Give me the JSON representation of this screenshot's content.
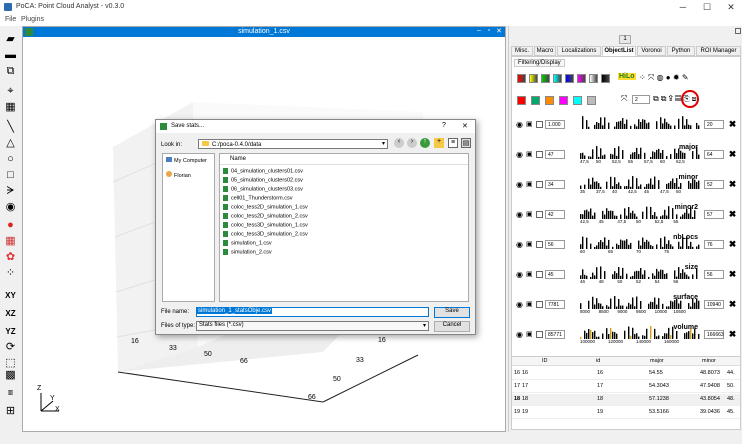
{
  "app": {
    "title": "PoCA: Point Cloud Analyst - v0.3.0",
    "menus": [
      "File",
      "Plugins"
    ]
  },
  "window_controls": {
    "minimize": "─",
    "maximize": "☐",
    "close": "✕"
  },
  "toolbar": {
    "icons": [
      "open-file-icon",
      "open-folder-icon",
      "screenshot-icon",
      "roi-select-icon",
      "line-roi-icon",
      "triangle-roi-icon",
      "circle-roi-icon",
      "square-roi-icon",
      "polyline-roi-icon",
      "sphere-roi-icon",
      "ellipse-icon",
      "grid-icon",
      "colormap-icon",
      "xy-view",
      "xz-view",
      "yz-view",
      "rotate-icon",
      "cube-select-icon",
      "grid-toggle-icon",
      "ruler-icon",
      "layout-icon"
    ],
    "labels": {
      "xy": "XY",
      "xz": "XZ",
      "yz": "YZ"
    }
  },
  "viewer": {
    "title": "simulation_1.csv",
    "axis_ticks_left": [
      "16",
      "33",
      "50",
      "66"
    ],
    "axis_ticks_right": [
      "16",
      "33",
      "50",
      "66"
    ],
    "axes": {
      "z": "Z",
      "y": "Y",
      "x": "X"
    }
  },
  "dialog": {
    "title": "Save stats...",
    "help": "?",
    "close": "✕",
    "look_in_label": "Look in:",
    "look_in_value": "C:/poca-0.4.0/data",
    "places": [
      "My Computer",
      "Florian"
    ],
    "name_header": "Name",
    "files": [
      "04_simulation_clusters01.csv",
      "05_simulation_clusters02.csv",
      "06_simulation_clusters03.csv",
      "cell01_Thunderstorm.csv",
      "coloc_tess2D_simulation_1.csv",
      "coloc_tess2D_simulation_2.csv",
      "coloc_tess3D_simulation_1.csv",
      "coloc_tess3D_simulation_2.csv",
      "simulation_1.csv",
      "simulation_2.csv"
    ],
    "filename_label": "File name:",
    "filename_value": "simulation_1_statsObje.csv",
    "filetype_label": "Files of type:",
    "filetype_value": "Stats files (*.csv)",
    "save": "Save",
    "cancel": "Cancel"
  },
  "panel": {
    "tab_index": "1",
    "tabs": [
      "Misc.",
      "Macro",
      "Localizations",
      "ObjectList",
      "Voronoi",
      "Python",
      "ROI Manager"
    ],
    "active_tab": "ObjectList",
    "subtab": "Filtering/Display",
    "palette_row1": [
      "#ff0000",
      "#ffff00",
      "#00cc00",
      "#00ffff",
      "#0000ff",
      "#ff00ff",
      "#ffffff",
      "#000000"
    ],
    "palette_row2": [
      "#ff0000",
      "#00a86b",
      "#ff8c00",
      "#ff00ff",
      "#00ffff",
      "#bbbbbb"
    ],
    "hilo": "HiLo",
    "point_size": "2",
    "histograms": [
      {
        "name": "",
        "left": "1.000",
        "right": "20",
        "ticks": []
      },
      {
        "name": "major",
        "left": "47",
        "right": "64",
        "ticks": [
          "47,5",
          "50",
          "52,5",
          "55",
          "57,5",
          "60",
          "62,5"
        ]
      },
      {
        "name": "minor",
        "left": "34",
        "right": "52",
        "ticks": [
          "35",
          "37,5",
          "40",
          "42,5",
          "45",
          "47,5",
          "50"
        ]
      },
      {
        "name": "minor2",
        "left": "42",
        "right": "57",
        "ticks": [
          "42,5",
          "45",
          "47,5",
          "50",
          "52,5",
          "55"
        ]
      },
      {
        "name": "nbLocs",
        "left": "56",
        "right": "76",
        "ticks": [
          "60",
          "65",
          "70",
          "75"
        ]
      },
      {
        "name": "size",
        "left": "45",
        "right": "56",
        "ticks": [
          "46",
          "48",
          "50",
          "52",
          "54",
          "56"
        ]
      },
      {
        "name": "surface",
        "left": "7781",
        "right": "10940",
        "ticks": [
          "8000",
          "8500",
          "9000",
          "9500",
          "10000",
          "10500"
        ]
      },
      {
        "name": "volume",
        "left": "85771",
        "right": "166663",
        "ticks": [
          "100000",
          "120000",
          "140000",
          "160000"
        ]
      }
    ],
    "table": {
      "headers": [
        "ID",
        "id",
        "major",
        "minor"
      ],
      "rows": [
        {
          "rowid": "16",
          "id": "16",
          "idv": "16",
          "major": "54.55",
          "minor": "48.8073",
          "extra": "44."
        },
        {
          "rowid": "17",
          "id": "17",
          "idv": "17",
          "major": "54.3043",
          "minor": "47.9408",
          "extra": "50."
        },
        {
          "rowid": "18",
          "id": "18",
          "idv": "18",
          "major": "57.1238",
          "minor": "43.8054",
          "extra": "48."
        },
        {
          "rowid": "19",
          "id": "19",
          "idv": "19",
          "major": "53.5166",
          "minor": "39.0436",
          "extra": "45."
        }
      ]
    }
  }
}
